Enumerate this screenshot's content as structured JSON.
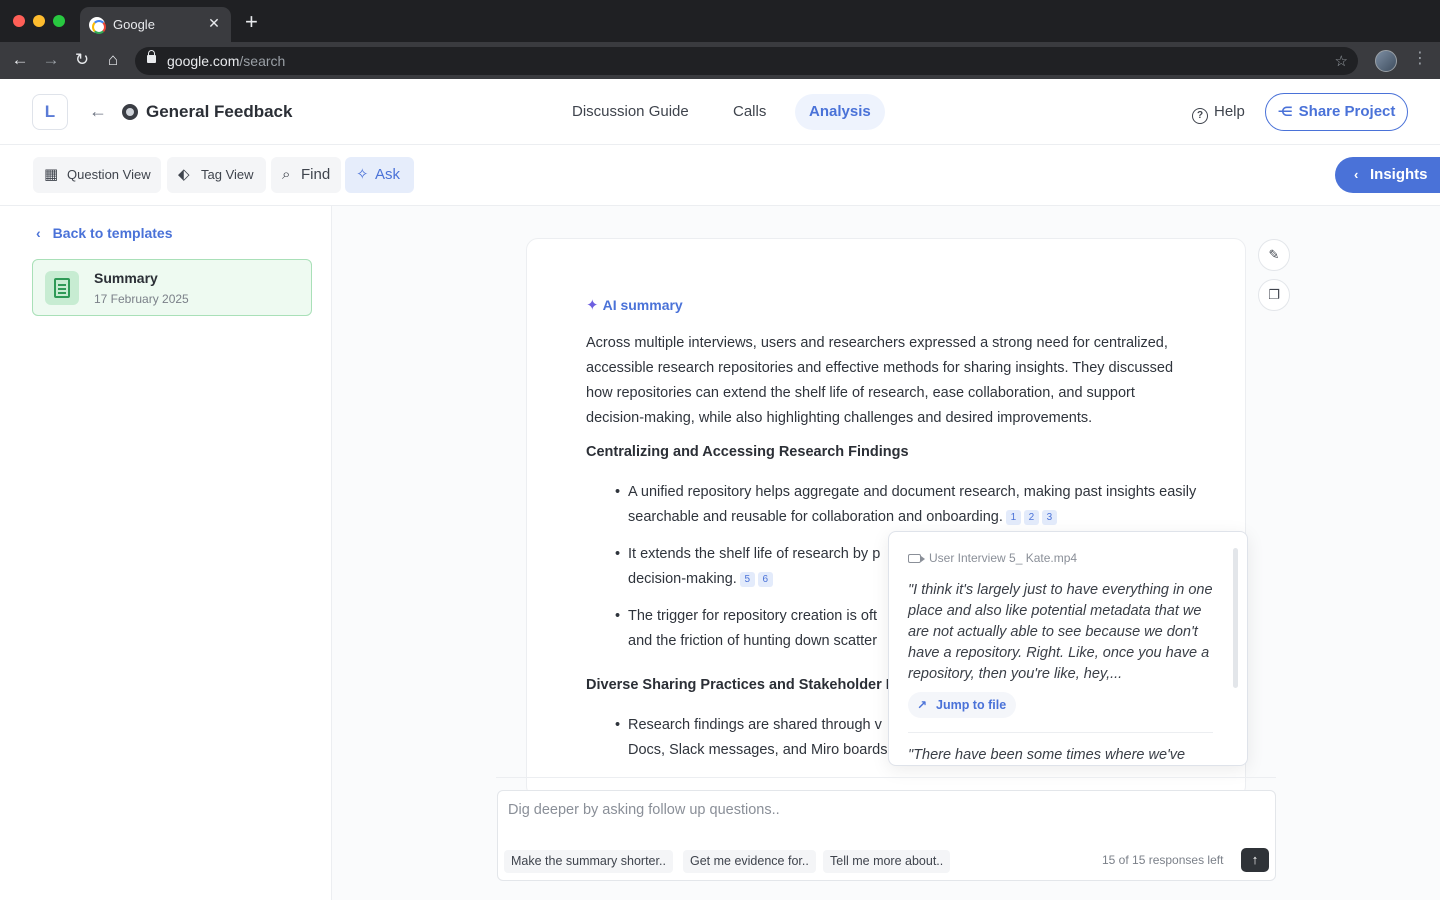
{
  "browser": {
    "tab_title": "Google",
    "url_host": "google.com",
    "url_path": "/search"
  },
  "header": {
    "logo_letter": "L",
    "project_title": "General Feedback",
    "tabs": [
      "Discussion Guide",
      "Calls",
      "Analysis"
    ],
    "active_tab": "Analysis",
    "help_label": "Help",
    "share_label": "Share Project"
  },
  "toolbar": {
    "buttons": [
      "Question View",
      "Tag View",
      "Find",
      "Ask"
    ],
    "active_button": "Ask",
    "insights_label": "Insights"
  },
  "sidebar": {
    "back_label": "Back to templates",
    "card_title": "Summary",
    "card_date": "17 February 2025"
  },
  "summary": {
    "heading": "AI summary",
    "intro": "Across multiple interviews, users and researchers expressed a strong need for centralized, accessible research repositories and effective methods for sharing insights. They discussed how repositories can extend the shelf life of research, ease collaboration, and support decision-making, while also highlighting challenges and desired improvements.",
    "sections": [
      {
        "title": "Centralizing and Accessing Research Findings",
        "bullets": [
          {
            "text": "A unified repository helps aggregate and document research, making past insights easily searchable and reusable for collaboration and onboarding.",
            "citations": [
              "1",
              "2",
              "3"
            ]
          },
          {
            "text": "It extends the shelf life of research by p",
            "line2": "decision-making.",
            "citations": [
              "5",
              "6"
            ]
          },
          {
            "text": "The trigger for repository creation is oft",
            "line2": "and the friction of hunting down scatter",
            "citations": []
          }
        ]
      },
      {
        "title": "Diverse Sharing Practices and Stakeholder N",
        "bullets": [
          {
            "text": "Research findings are shared through v",
            "line2": "Docs, Slack messages, and Miro boards",
            "citations": []
          }
        ]
      }
    ]
  },
  "evidence_popover": {
    "file_name": "User Interview 5_ Kate.mp4",
    "quote": "\"I think it's largely just to have everything in one place and also like potential metadata that we are not actually able to see because we don't have a repository. Right. Like, once you have a repository, then you're like, hey,...",
    "jump_label": "Jump to file",
    "next_quote": "\"There have been some times where we've"
  },
  "ask": {
    "placeholder": "Dig deeper by asking follow up questions..",
    "chips": [
      "Make the summary shorter..",
      "Get me evidence for..",
      "Tell me more about.."
    ],
    "responses_left": "15 of 15 responses left"
  },
  "colors": {
    "accent": "#4a72d8",
    "summary_card_bg": "#eefaf1",
    "summary_card_border": "#a9e0b8"
  }
}
